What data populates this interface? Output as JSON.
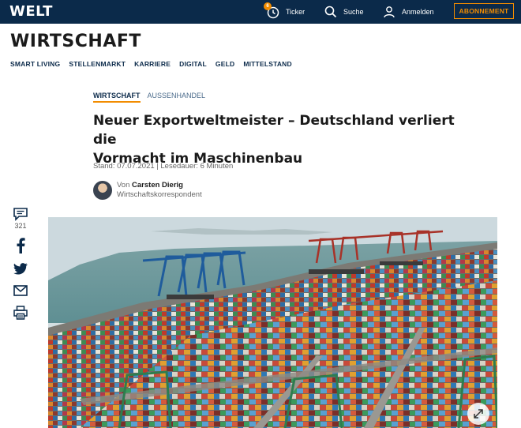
{
  "brand": {
    "logo": "WELT"
  },
  "topbar": {
    "ticker_label": "Ticker",
    "ticker_badge": "6",
    "search_label": "Suche",
    "login_label": "Anmelden",
    "subscribe_label": "ABONNEMENT",
    "bg_color": "#0b2a4a",
    "accent_color": "#f28c00"
  },
  "section": {
    "title": "WIRTSCHAFT"
  },
  "subnav": {
    "items": [
      "SMART LIVING",
      "STELLENMARKT",
      "KARRIERE",
      "DIGITAL",
      "GELD",
      "MITTELSTAND"
    ]
  },
  "article": {
    "kicker_primary": "WIRTSCHAFT",
    "kicker_secondary": "AUSSENHANDEL",
    "headline_line1": "Neuer Exportweltmeister – Deutschland verliert die",
    "headline_line2": "Vormacht im Maschinenbau",
    "meta": "Stand: 07.07.2021 | Lesedauer: 6 Minuten",
    "author_prefix": "Von",
    "author_name": "Carsten Dierig",
    "author_role": "Wirtschaftskorrespondent"
  },
  "share": {
    "comment_count": "321",
    "icons": [
      "comment-icon",
      "facebook-icon",
      "twitter-icon",
      "mail-icon",
      "print-icon"
    ]
  },
  "hero_image": {
    "subject": "container port aerial view",
    "icon": "expand-icon"
  }
}
